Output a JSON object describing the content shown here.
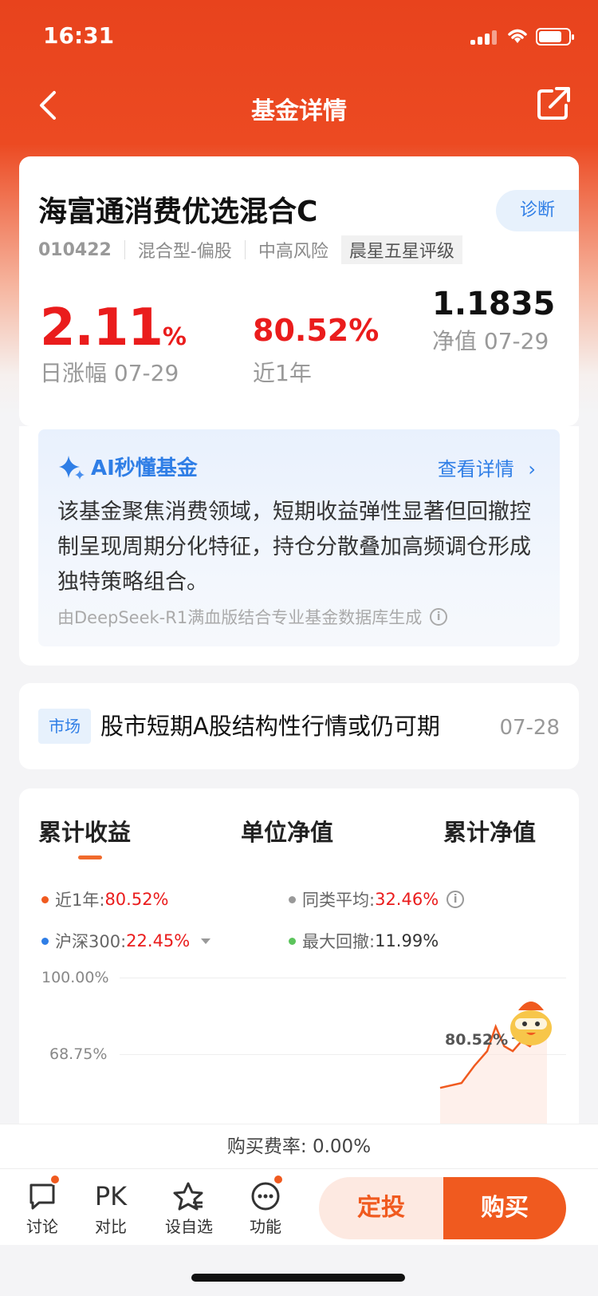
{
  "status_bar": {
    "time": "16:31"
  },
  "nav": {
    "title": "基金详情"
  },
  "fund": {
    "name": "海富通消费优选混合C",
    "diagnose_label": "诊断",
    "code": "010422",
    "type": "混合型-偏股",
    "risk": "中高风险",
    "rating": "晨星五星评级",
    "daily_change_value": "2.11",
    "daily_change_unit": "%",
    "daily_change_label": "日涨幅 07-29",
    "one_year_return": "80.52%",
    "one_year_label": "近1年",
    "nav_value": "1.1835",
    "nav_label": "净值 07-29"
  },
  "ai": {
    "title": "AI秒懂基金",
    "more_label": "查看详情",
    "text": "该基金聚焦消费领域，短期收益弹性显著但回撤控制呈现周期分化特征，持仓分散叠加高频调仓形成独特策略组合。",
    "source": "由DeepSeek-R1满血版结合专业基金数据库生成"
  },
  "news": {
    "tag": "市场",
    "title": "股市短期A股结构性行情或仍可期",
    "date": "07-28"
  },
  "chart_tabs": [
    "累计收益",
    "单位净值",
    "累计净值"
  ],
  "legend": {
    "item1_label": "近1年:",
    "item1_value": "80.52%",
    "item2_label": "同类平均:",
    "item2_value": "32.46%",
    "item3_label": "沪深300:",
    "item3_value": "22.45%",
    "item4_label": "最大回撤:",
    "item4_value": "11.99%"
  },
  "colors": {
    "accent": "#f05a1f",
    "up": "#ea1c1c",
    "blue": "#2f7ee6",
    "series1": "#f05a1f",
    "series2": "#999999",
    "series3": "#2f7ee6",
    "series4": "#5cc45c"
  },
  "chart_data": {
    "type": "line",
    "y_tick_labels": [
      "100.00%",
      "68.75%"
    ],
    "end_label": "80.52%",
    "series": [
      {
        "name": "近1年",
        "x": [
          0.75,
          0.8,
          0.83,
          0.86,
          0.88,
          0.9,
          0.92,
          0.94,
          0.96,
          0.98,
          1.0
        ],
        "values": [
          55,
          57,
          64,
          70,
          80,
          72,
          70,
          74,
          72,
          77,
          80.52
        ]
      }
    ],
    "ylim": [
      50,
      100
    ]
  },
  "fee": {
    "text": "购买费率: 0.00%"
  },
  "bottom": {
    "discuss": "讨论",
    "compare_icon": "PK",
    "compare": "对比",
    "watch": "设自选",
    "more": "功能",
    "invest": "定投",
    "buy": "购买"
  }
}
